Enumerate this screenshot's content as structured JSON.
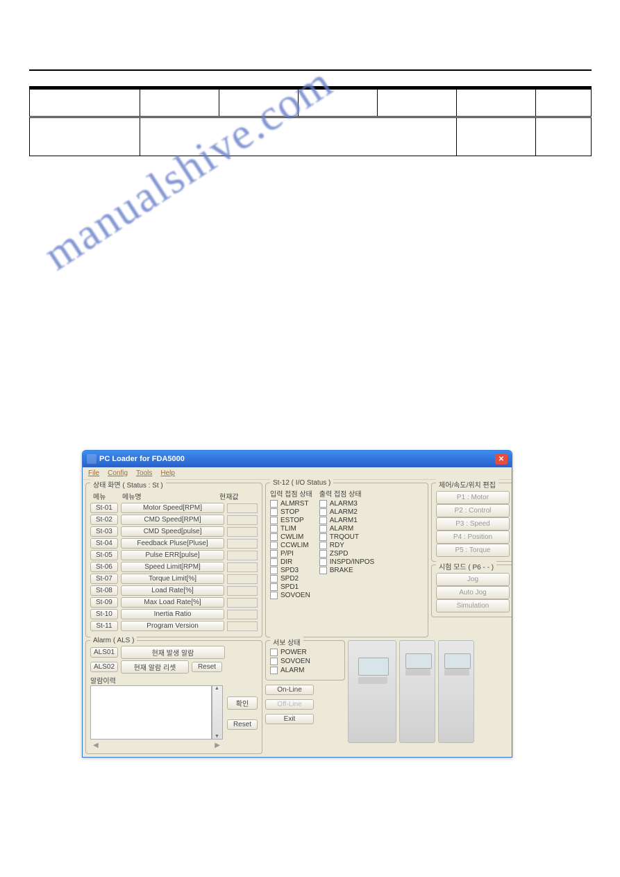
{
  "watermark": "manualshive.com",
  "app": {
    "title": "PC Loader for FDA5000",
    "menu": [
      "File",
      "Config",
      "Tools",
      "Help"
    ],
    "status_group": {
      "title": "상태 화면 ( Status : St )",
      "headers": {
        "menu": "메뉴",
        "name": "메뉴명",
        "val": "현재값"
      },
      "rows": [
        {
          "code": "St-01",
          "name": "Motor Speed[RPM]"
        },
        {
          "code": "St-02",
          "name": "CMD Speed[RPM]"
        },
        {
          "code": "St-03",
          "name": "CMD Speed[pulse]"
        },
        {
          "code": "St-04",
          "name": "Feedback Pluse[Pluse]"
        },
        {
          "code": "St-05",
          "name": "Pulse ERR[pulse]"
        },
        {
          "code": "St-06",
          "name": "Speed Limit[RPM]"
        },
        {
          "code": "St-07",
          "name": "Torque Limit[%]"
        },
        {
          "code": "St-08",
          "name": "Load Rate[%]"
        },
        {
          "code": "St-09",
          "name": "Max Load Rate[%]"
        },
        {
          "code": "St-10",
          "name": "Inertia Ratio"
        },
        {
          "code": "St-11",
          "name": "Program Version"
        }
      ]
    },
    "io_group": {
      "title": "St-12 ( I/O Status )",
      "input_title": "입력 접점 상태",
      "output_title": "출력 접점 상태",
      "inputs": [
        "ALMRST",
        "STOP",
        "ESTOP",
        "TLIM",
        "CWLIM",
        "CCWLIM",
        "P/PI",
        "DIR",
        "SPD3",
        "SPD2",
        "SPD1",
        "SOVOEN"
      ],
      "outputs": [
        "ALARM3",
        "ALARM2",
        "ALARM1",
        "ALARM",
        "TRQOUT",
        "RDY",
        "ZSPD",
        "INSPD/INPOS",
        "BRAKE"
      ]
    },
    "ctrl_group": {
      "title": "제어/속도/위치 편집",
      "buttons": [
        "P1 : Motor",
        "P2 : Control",
        "P3 : Speed",
        "P4 : Position",
        "P5 : Torque"
      ]
    },
    "test_group": {
      "title": "시험 모드 ( P6 - - )",
      "buttons": [
        "Jog",
        "Auto Jog",
        "Simulation"
      ]
    },
    "alarm_group": {
      "title": "Alarm ( ALS )",
      "row1": {
        "code": "ALS01",
        "name": "현재 발생 알람"
      },
      "row2": {
        "code": "ALS02",
        "name": "현재 알람 리셋"
      },
      "reset": "Reset",
      "hist_title": "알람이력",
      "btn_confirm": "확인",
      "btn_reset": "Reset"
    },
    "servo_group": {
      "title": "서보 상태",
      "items": [
        "POWER",
        "SOVOEN",
        "ALARM"
      ]
    },
    "action_buttons": {
      "online": "On-Line",
      "offline": "Off-Line",
      "exit": "Exit"
    }
  }
}
